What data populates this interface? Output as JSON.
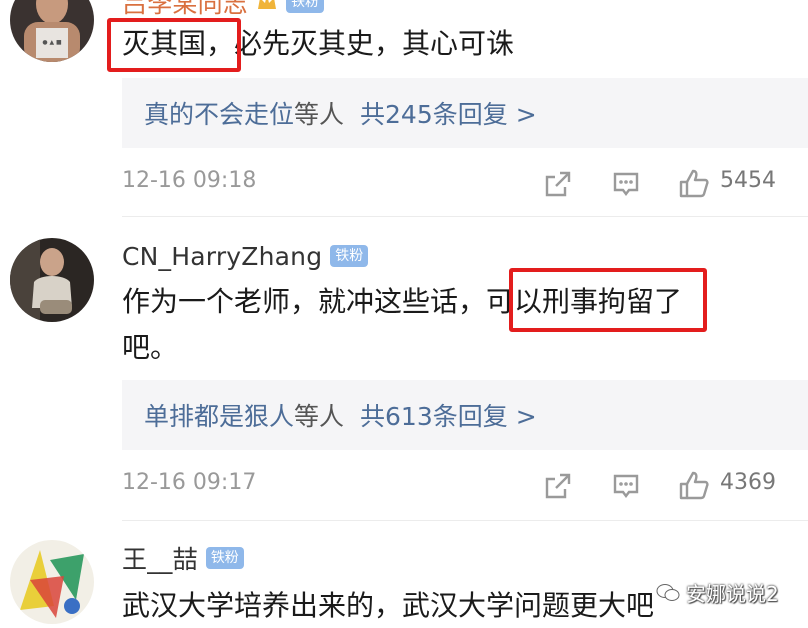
{
  "comments": [
    {
      "username": "吕李某同志",
      "badge": "铁粉",
      "text_highlight": "灭其国，",
      "text_rest": "必先灭其史，其心可诛",
      "reply": {
        "user": "真的不会走位",
        "suffix": "等人",
        "count": "共245条回复 >"
      },
      "time": "12-16 09:18",
      "likes": "5454"
    },
    {
      "username": "CN_HarryZhang",
      "badge": "铁粉",
      "text_line1_before": "作为一个老师，就冲这些话，",
      "text_highlight": "可以刑事拘留",
      "text_line1_after": "了",
      "text_line2": "吧。",
      "reply": {
        "user": "单排都是狠人",
        "suffix": "等人",
        "count": "共613条回复 >"
      },
      "time": "12-16 09:17",
      "likes": "4369"
    },
    {
      "username": "王__喆",
      "badge": "铁粉",
      "text": "武汉大学培养出来的，武汉大学问题更大吧"
    }
  ],
  "watermark": "安娜说说2",
  "icons": {
    "share": "share-icon",
    "comment": "comment-icon",
    "like": "thumbs-up-icon",
    "watermark": "wechat-icon"
  },
  "colors": {
    "highlight": "#e31d1d",
    "link": "#4d6d98",
    "badge": "#8fb8ea"
  }
}
